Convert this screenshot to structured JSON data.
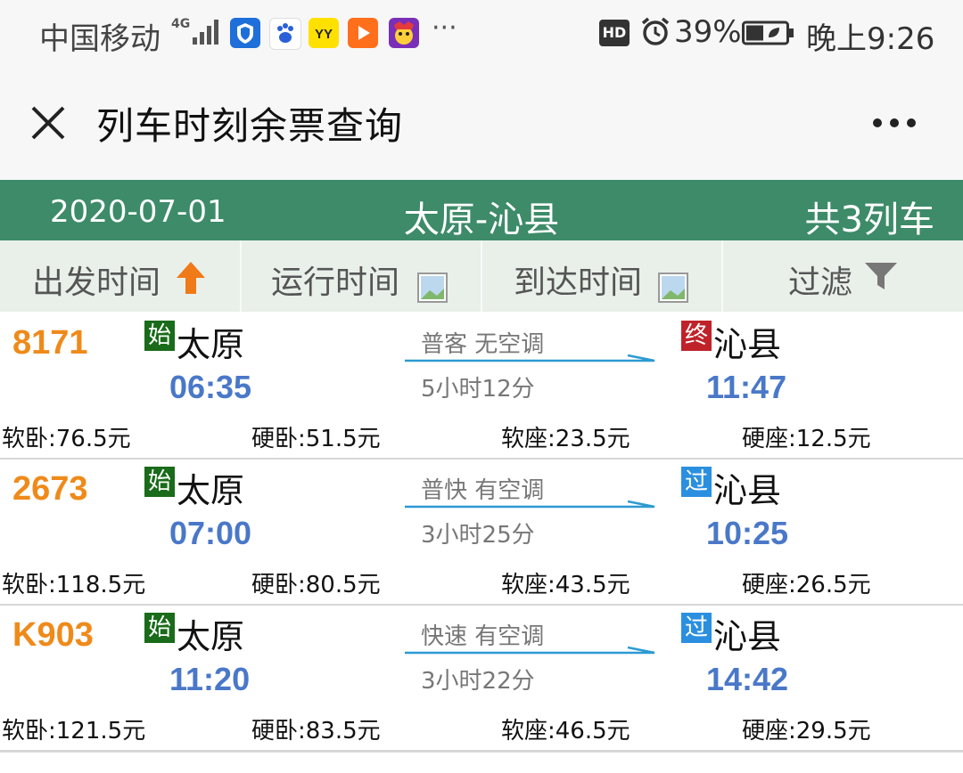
{
  "status_bar": {
    "carrier": "中国移动",
    "network": "4G",
    "battery_percent": "39%",
    "time": "晚上9:26",
    "hd_badge": "HD",
    "more": "···"
  },
  "title_bar": {
    "title": "列车时刻余票查询"
  },
  "header": {
    "date": "2020-07-01",
    "route": "太原-沁县",
    "count": "共3列车"
  },
  "sort_bar": {
    "departure": "出发时间",
    "duration": "运行时间",
    "arrival": "到达时间",
    "filter": "过滤"
  },
  "trains": [
    {
      "number": "8171",
      "from_badge": "始",
      "from": "太原",
      "dep_time": "06:35",
      "type": "普客  无空调",
      "duration": "5小时12分",
      "to_badge": "终",
      "to": "沁县",
      "arr_time": "11:47",
      "prices": [
        "软卧:76.5元",
        "硬卧:51.5元",
        "软座:23.5元",
        "硬座:12.5元"
      ]
    },
    {
      "number": "2673",
      "from_badge": "始",
      "from": "太原",
      "dep_time": "07:00",
      "type": "普快  有空调",
      "duration": "3小时25分",
      "to_badge": "过",
      "to": "沁县",
      "arr_time": "10:25",
      "prices": [
        "软卧:118.5元",
        "硬卧:80.5元",
        "软座:43.5元",
        "硬座:26.5元"
      ]
    },
    {
      "number": "K903",
      "from_badge": "始",
      "from": "太原",
      "dep_time": "11:20",
      "type": "快速  有空调",
      "duration": "3小时22分",
      "to_badge": "过",
      "to": "沁县",
      "arr_time": "14:42",
      "prices": [
        "软卧:121.5元",
        "硬卧:83.5元",
        "软座:46.5元",
        "硬座:29.5元"
      ]
    }
  ],
  "colors": {
    "header_green": "#3d8b69",
    "train_number_orange": "#ef8a1a",
    "time_blue": "#4a78c8",
    "start_badge_green": "#1a6b1a",
    "end_badge_red": "#c0222a",
    "pass_badge_blue": "#2b8fe0"
  }
}
